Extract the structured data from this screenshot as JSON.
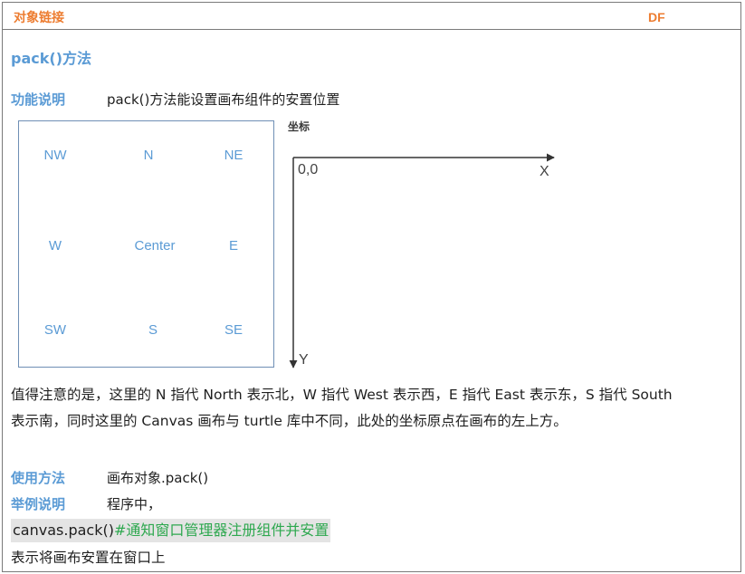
{
  "header": {
    "title": "对象链接",
    "tag": "DF"
  },
  "section": {
    "title": "pack()方法"
  },
  "feature": {
    "label": "功能说明",
    "text": "pack()方法能设置画布组件的安置位置"
  },
  "compass": {
    "nw": "NW",
    "n": "N",
    "ne": "NE",
    "w": "W",
    "center": "Center",
    "e": "E",
    "sw": "SW",
    "s": "S",
    "se": "SE"
  },
  "coords": {
    "label": "坐标",
    "origin": "0,0",
    "x": "X",
    "y": "Y"
  },
  "note": {
    "line1": "值得注意的是，这里的 N 指代 North 表示北，W 指代 West 表示西，E 指代 East 表示东，S 指代 South",
    "line2": "表示南，同时这里的 Canvas 画布与 turtle 库中不同，此处的坐标原点在画布的左上方。"
  },
  "usage": {
    "label": "使用方法",
    "text": "画布对象.pack()"
  },
  "example": {
    "label": "举例说明",
    "text": "程序中，"
  },
  "code": {
    "main": "canvas.pack()",
    "comment": "#通知窗口管理器注册组件并安置"
  },
  "result": {
    "text": "表示将画布安置在窗口上"
  },
  "colors": {
    "accent_orange": "#ed7d31",
    "accent_blue": "#5b9bd5",
    "code_green": "#2ea84f",
    "code_bg": "#e4e4e4"
  }
}
